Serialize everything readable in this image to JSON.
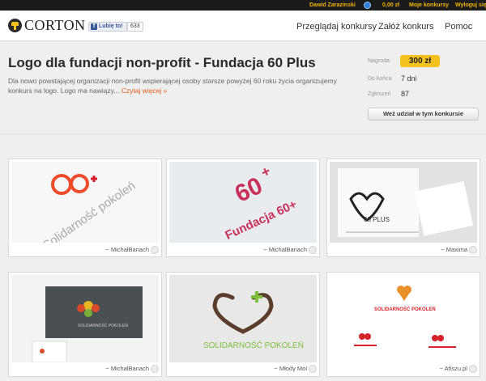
{
  "topbar": {
    "user": "Dawid Zarazinski",
    "balance": "0,00 zł",
    "my_contests": "Moje konkursy",
    "logout": "Wyloguj się"
  },
  "header": {
    "logo_text": "CORTON",
    "fb_like": "Lubię to!",
    "fb_count": "633",
    "nav": {
      "browse": "Przeglądaj konkursy",
      "create": "Załóż konkurs",
      "help": "Pomoc"
    }
  },
  "contest": {
    "title": "Logo dla fundacji non-profit - Fundacja 60 Plus",
    "description": "Dla nowo powstającej organizacji non-profit wspierającej osoby starsze powyżej 60 roku życia organizujemy konkurs na logo. Logo ma nawiązy...",
    "read_more": "Czytaj więcej »",
    "prize_label": "Nagroda",
    "prize_value": "300 zł",
    "time_left_label": "Do końca",
    "time_left_value": "7 dni",
    "entries_label": "Zgłoszeń",
    "entries_value": "87",
    "join_button": "Weź udział w tym konkursie"
  },
  "entries": [
    {
      "author": "~ MichalBanach",
      "design_text": "Solidarność pokoleń"
    },
    {
      "author": "~ MichalBanach",
      "design_text": "Fundacja 60+"
    },
    {
      "author": "~ Maxima",
      "design_text": "60 PLUS"
    },
    {
      "author": "~ MichalBanach",
      "design_text": "SOLIDARNOŚĆ POKOLEŃ"
    },
    {
      "author": "~ Młody Mol",
      "design_text": "SOLIDARNOŚĆ POKOLEŃ"
    },
    {
      "author": "~ Afiszu.pl",
      "design_text": "SOLIDARNOŚĆ POKOLEŃ"
    }
  ],
  "colors": {
    "accent": "#f4c21e",
    "topbar_link": "#f2b40a",
    "read_more": "#e25a1c"
  }
}
